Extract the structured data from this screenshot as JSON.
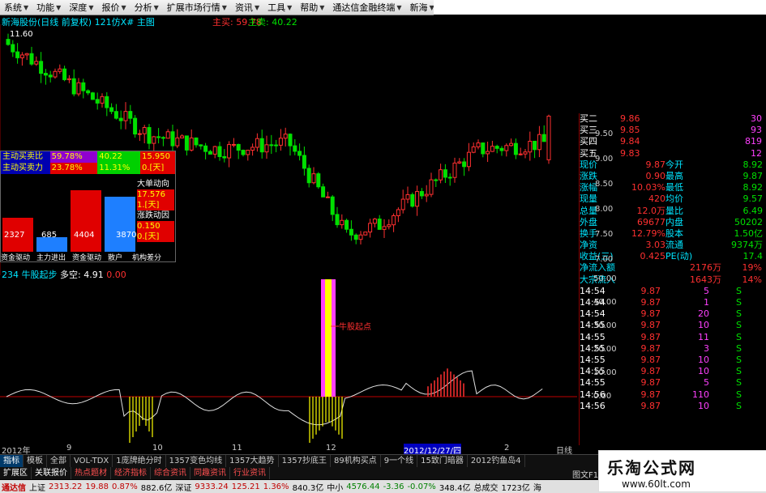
{
  "menu": {
    "items": [
      {
        "label": "系统"
      },
      {
        "label": "功能"
      },
      {
        "label": "深度"
      },
      {
        "label": "报价"
      },
      {
        "label": "分析"
      },
      {
        "label": "扩展市场行情"
      },
      {
        "label": "资讯"
      },
      {
        "label": "工具"
      },
      {
        "label": "帮助"
      },
      {
        "label": "通达信金融终端"
      },
      {
        "label": "新海"
      }
    ]
  },
  "header": {
    "stock": "新海股份(日线 前复权)",
    "code": "121仿X# 主图",
    "main_buy_label": "主买:",
    "main_buy_value": "59.78",
    "main_sell_label": "主卖:",
    "main_sell_value": "40.22"
  },
  "price_high_label": "11.60",
  "infobox": {
    "r1": {
      "label": "主动买卖比",
      "v1": "59.78%",
      "v2": "40.22",
      "v3": "15.950"
    },
    "r2": {
      "label": "主动买卖力",
      "v1": "23.78%",
      "v2": "11.31%",
      "v3": "0.[天]"
    },
    "bars": {
      "v1": "2327",
      "v2": "685",
      "v3": "4404",
      "v4": "3870"
    },
    "right_labels": {
      "a": "大单动向",
      "b": "17.576",
      "c": "1.[天]",
      "d": "涨跌动因",
      "e": "0.150",
      "f": "0.[天]"
    },
    "footer": [
      "资金驱动",
      "主力进出",
      "资金驱动",
      "散户",
      "机构差分"
    ]
  },
  "indicator": {
    "name": "234 牛股起步",
    "mode": "多空:",
    "value": "4.91",
    "zero": "0.00",
    "annotation": "牛股起点"
  },
  "y_axis_price": [
    "9.50",
    "9.00",
    "8.50",
    "8.00",
    "7.50",
    "7.00"
  ],
  "y_axis_ind": [
    "50.00",
    "40.00",
    "30.00",
    "20.00",
    "10.00",
    "0.00"
  ],
  "x_axis": {
    "labels": [
      "2012年",
      "9",
      "10",
      "11",
      "12",
      "2012/12/27/四",
      "2"
    ],
    "right": "日线"
  },
  "quote": {
    "rows": [
      {
        "l": "买二",
        "v": "9.86",
        "r": "30"
      },
      {
        "l": "买三",
        "v": "9.85",
        "r": "93"
      },
      {
        "l": "买四",
        "v": "9.84",
        "r": "819"
      },
      {
        "l": "买五",
        "v": "9.83",
        "r": "12"
      }
    ],
    "stats": [
      {
        "a": "现价",
        "b": "9.87",
        "c": "今开",
        "d": "8.92"
      },
      {
        "a": "涨跌",
        "b": "0.90",
        "c": "最高",
        "d": "9.87"
      },
      {
        "a": "涨幅",
        "b": "10.03%",
        "c": "最低",
        "d": "8.92"
      },
      {
        "a": "现量",
        "b": "420",
        "c": "均价",
        "d": "9.57"
      },
      {
        "a": "总量",
        "b": "12.0万",
        "c": "量比",
        "d": "6.49"
      },
      {
        "a": "外盘",
        "b": "69677",
        "c": "内盘",
        "d": "50202"
      },
      {
        "a": "换手",
        "b": "12.79%",
        "c": "股本",
        "d": "1.50亿"
      },
      {
        "a": "净资",
        "b": "3.03",
        "c": "流通",
        "d": "9374万"
      },
      {
        "a": "收益(三)",
        "b": "0.425",
        "c": "PE(动)",
        "d": "17.4"
      }
    ],
    "flow": [
      {
        "a": "净流入额",
        "b": "2176万",
        "c": "19%"
      },
      {
        "a": "大宗流入",
        "b": "1643万",
        "c": "14%"
      }
    ],
    "ticks": [
      {
        "t": "14:54",
        "p": "9.87",
        "v": "5",
        "s": "S"
      },
      {
        "t": "14:54",
        "p": "9.87",
        "v": "1",
        "s": "S"
      },
      {
        "t": "14:54",
        "p": "9.87",
        "v": "20",
        "s": "S"
      },
      {
        "t": "14:55",
        "p": "9.87",
        "v": "10",
        "s": "S"
      },
      {
        "t": "14:55",
        "p": "9.87",
        "v": "11",
        "s": "S"
      },
      {
        "t": "14:55",
        "p": "9.87",
        "v": "3",
        "s": "S"
      },
      {
        "t": "14:55",
        "p": "9.87",
        "v": "10",
        "s": "S"
      },
      {
        "t": "14:55",
        "p": "9.87",
        "v": "10",
        "s": "S"
      },
      {
        "t": "14:55",
        "p": "9.87",
        "v": "5",
        "s": "S"
      },
      {
        "t": "14:56",
        "p": "9.87",
        "v": "110",
        "s": "S"
      },
      {
        "t": "14:56",
        "p": "9.87",
        "v": "10",
        "s": "S"
      }
    ]
  },
  "tabs1": [
    "指标",
    "模板",
    "全部",
    "VOL-TDX",
    "1庞牌绝分时",
    "1357变色均线",
    "1357大趋势",
    "1357抄底王",
    "89机构买点",
    "9一个线",
    "15致门暗器",
    "2012钓鱼岛4"
  ],
  "tabs2": [
    "扩展区",
    "关联报价",
    "热点题材",
    "经济指标",
    "综合资讯",
    "同趣资讯",
    "行业资讯"
  ],
  "status": {
    "brand": "通达信",
    "sh_label": "上证",
    "sh": "2313.22",
    "sh_chg": "19.88",
    "sh_pct": "0.87%",
    "sh_amt": "882.6亿",
    "sz_label": "深证",
    "sz": "9333.24",
    "sz_chg": "125.21",
    "sz_pct": "1.36%",
    "sz_amt": "840.3亿",
    "zx_label": "中小",
    "zx": "4576.44",
    "zx_chg": "-3.36",
    "zx_pct": "-0.07%",
    "zx_amt": "348.4亿",
    "total_label": "总成交",
    "total": "1723亿",
    "tail": "海",
    "right_tab": "图文F10"
  },
  "watermark": {
    "title": "乐淘公式网",
    "url": "www.60lt.com"
  },
  "colors": {
    "up": "#ff3030",
    "down": "#00e000",
    "axis": "#8a0000",
    "cyan": "#00e5ff"
  }
}
